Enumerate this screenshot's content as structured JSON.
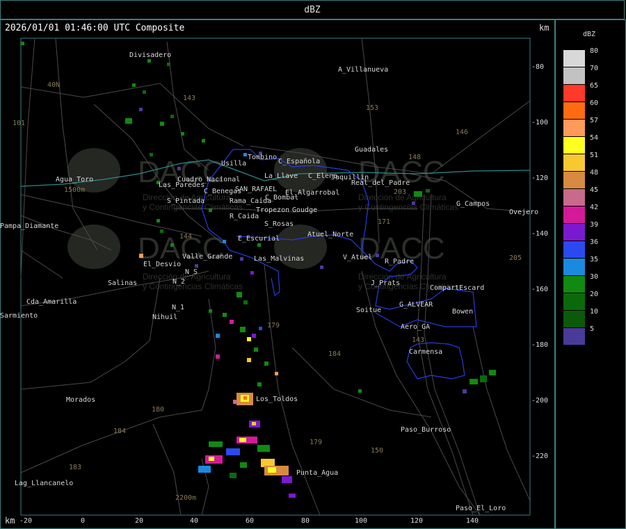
{
  "header": {
    "title": "dBZ"
  },
  "map": {
    "timestamp": "2026/01/01 01:46:00 UTC Composite",
    "km_unit_top": "km",
    "km_unit_bottom": "km",
    "x_ticks": [
      "-20",
      "0",
      "20",
      "40",
      "60",
      "80",
      "100",
      "120",
      "140"
    ],
    "y_ticks": [
      "-80",
      "-100",
      "-120",
      "-140",
      "-160",
      "-180",
      "-200",
      "-220"
    ],
    "watermark": {
      "logo_text": "DACC",
      "sub1": "Dirección de Agricultura",
      "sub2": "y Contingencias Climáticas"
    },
    "places": [
      "Divisadero",
      "A_Villanueva",
      "Guadales",
      "Tombino",
      "Usilla",
      "C_Española",
      "C_Elena",
      "Jaquillin",
      "Real_del_Padre",
      "Agua_Toro",
      "Las_Paredes",
      "S_Pintada",
      "Cuadro_Nacional",
      "C_Benegas",
      "SAN_RAFAEL",
      "La_Llave",
      "C_Bombal",
      "El_Algarrobal",
      "Rama_Caída",
      "R_Caida",
      "Tropezon",
      "Goudge",
      "G_Campos",
      "Ovejero",
      "Pampa_Diamante",
      "S_Rosas",
      "Atuel_Norte",
      "E_Escurial",
      "El_Desvio",
      "Valle_Grande",
      "Las_Malvinas",
      "V_Atuel",
      "R_Padre",
      "Salinas",
      "N_2",
      "N_S",
      "J_Prats",
      "CompartEscard",
      "Cda_Amarilla",
      "G_ALVEAR",
      "Bowen",
      "N_1",
      "Soitue",
      "Nihuil",
      "Aero_GA",
      "Carmensa",
      "Morados",
      "Los_Toldos",
      "Paso_Burroso",
      "Punta_Agua",
      "Lag_Llancanelo",
      "Paso_El_Loro",
      "Sarmiento",
      "40N",
      "1500m",
      "2200m"
    ],
    "routes": [
      "101",
      "143",
      "153",
      "146",
      "148",
      "203",
      "171",
      "144",
      "179",
      "184",
      "180",
      "179",
      "150",
      "184",
      "183",
      "143",
      "205"
    ]
  },
  "legend": {
    "title": "dBZ",
    "scale": [
      {
        "label": "80",
        "color": "#d8d8d8"
      },
      {
        "label": "70",
        "color": "#c2c2c2"
      },
      {
        "label": "65",
        "color": "#ff3a2a"
      },
      {
        "label": "60",
        "color": "#ff6b10"
      },
      {
        "label": "57",
        "color": "#ff9a5a"
      },
      {
        "label": "54",
        "color": "#ffff20"
      },
      {
        "label": "51",
        "color": "#f8c830"
      },
      {
        "label": "48",
        "color": "#d88a40"
      },
      {
        "label": "45",
        "color": "#c86a8a"
      },
      {
        "label": "42",
        "color": "#d41a9a"
      },
      {
        "label": "39",
        "color": "#7a1ad0"
      },
      {
        "label": "36",
        "color": "#2a4af0"
      },
      {
        "label": "35",
        "color": "#1a8ae0"
      },
      {
        "label": "30",
        "color": "#108a10"
      },
      {
        "label": "20",
        "color": "#0a6a0a"
      },
      {
        "label": "10",
        "color": "#0a5a0a"
      },
      {
        "label": "5",
        "color": "#4a3a9a"
      }
    ]
  }
}
